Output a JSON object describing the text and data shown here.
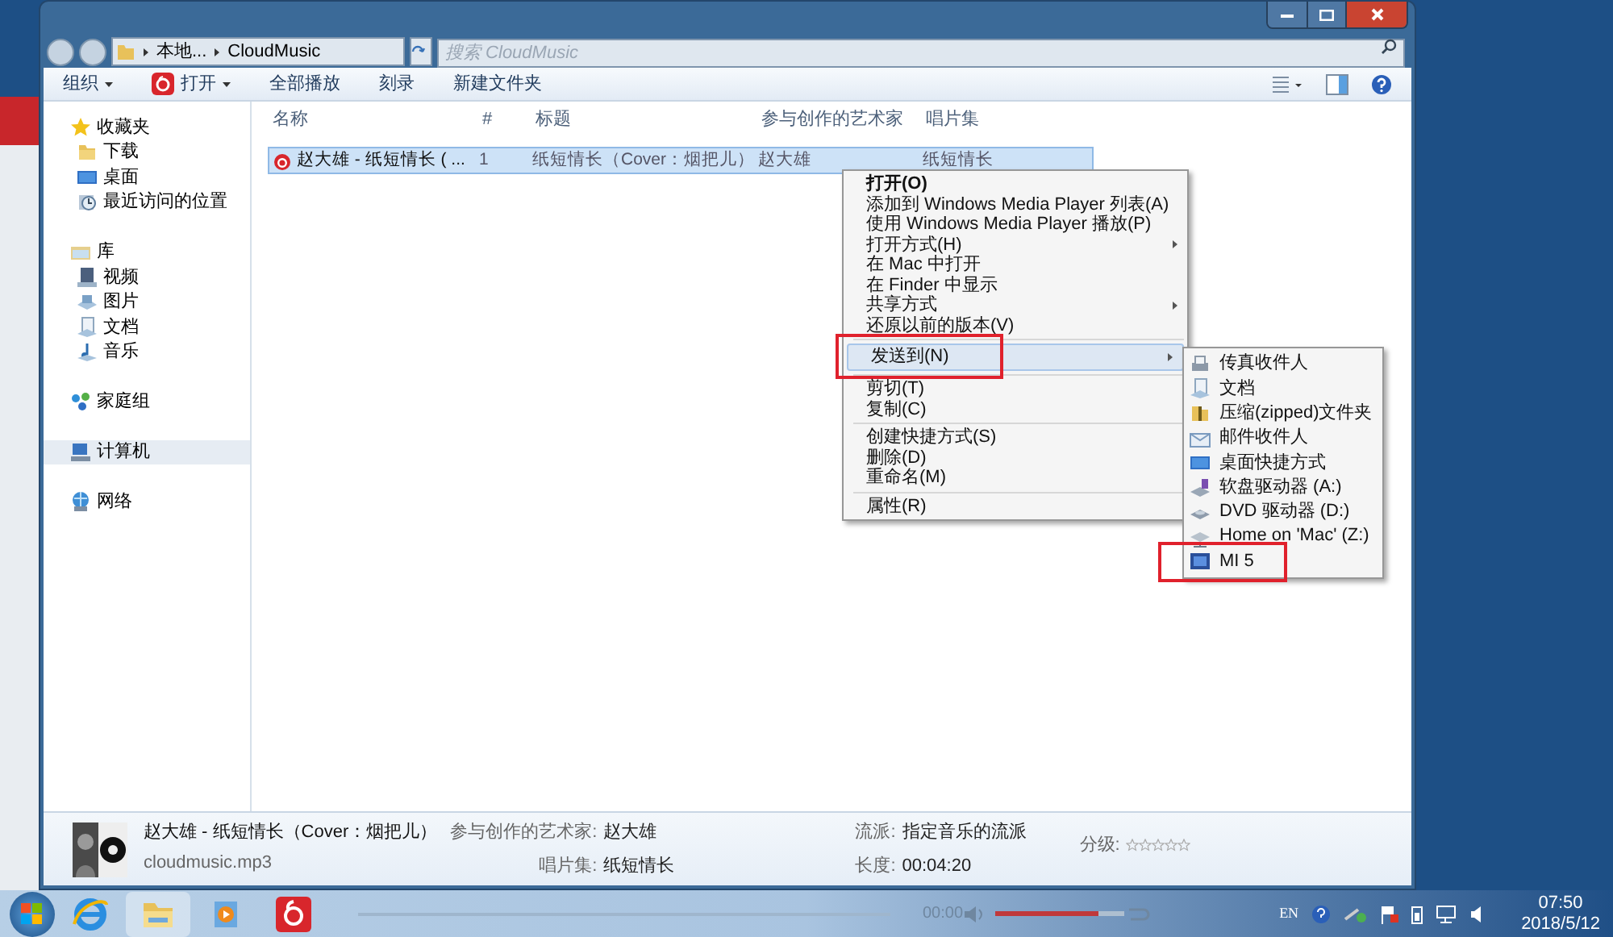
{
  "window": {
    "address": [
      "本地...",
      "CloudMusic"
    ],
    "search": {
      "placeholder": "搜索 CloudMusic"
    }
  },
  "toolbar": [
    {
      "label": "组织",
      "kind": "plain",
      "dropdown": true
    },
    {
      "label": "打开",
      "kind": "app",
      "dropdown": true
    },
    {
      "label": "全部播放",
      "kind": "plain",
      "dropdown": false
    },
    {
      "label": "刻录",
      "kind": "plain",
      "dropdown": false
    },
    {
      "label": "新建文件夹",
      "kind": "plain",
      "dropdown": false
    }
  ],
  "nav": [
    {
      "label": "收藏夹",
      "kind": "star",
      "selected": false,
      "children": [
        {
          "label": "下载",
          "kind": "folder",
          "selected": false
        },
        {
          "label": "桌面",
          "kind": "desktop",
          "selected": false
        },
        {
          "label": "最近访问的位置",
          "kind": "recent",
          "selected": false
        }
      ]
    },
    {
      "label": "库",
      "kind": "library",
      "selected": false,
      "children": [
        {
          "label": "视频",
          "kind": "video",
          "selected": false
        },
        {
          "label": "图片",
          "kind": "picture",
          "selected": false
        },
        {
          "label": "文档",
          "kind": "document",
          "selected": false
        },
        {
          "label": "音乐",
          "kind": "music",
          "selected": false
        }
      ]
    },
    {
      "label": "家庭组",
      "kind": "homegroup",
      "selected": false
    },
    {
      "label": "计算机",
      "kind": "computer",
      "selected": true
    },
    {
      "label": "网络",
      "kind": "network",
      "selected": false
    }
  ],
  "table": {
    "columns": [
      "名称",
      "#",
      "标题",
      "参与创作的艺术家",
      "唱片集"
    ],
    "rows": [
      {
        "cells": [
          "赵大雄 - 纸短情长 ( ...",
          "1",
          "纸短情长（Cover：烟把儿）",
          "赵大雄",
          "纸短情长"
        ],
        "selected": true
      }
    ]
  },
  "context_menu": {
    "groups": [
      [
        {
          "label": "打开(O)",
          "bold": true,
          "submenu": false,
          "selected": false,
          "annotated": false
        },
        {
          "label": "添加到 Windows Media Player 列表(A)",
          "bold": false,
          "submenu": false,
          "selected": false,
          "annotated": false
        },
        {
          "label": "使用 Windows Media Player 播放(P)",
          "bold": false,
          "submenu": false,
          "selected": false,
          "annotated": false
        },
        {
          "label": "打开方式(H)",
          "bold": false,
          "submenu": true,
          "selected": false,
          "annotated": false
        },
        {
          "label": "在 Mac 中打开",
          "bold": false,
          "submenu": false,
          "selected": false,
          "annotated": false
        },
        {
          "label": "在 Finder 中显示",
          "bold": false,
          "submenu": false,
          "selected": false,
          "annotated": false
        },
        {
          "label": "共享方式",
          "bold": false,
          "submenu": true,
          "selected": false,
          "annotated": false
        },
        {
          "label": "还原以前的版本(V)",
          "bold": false,
          "submenu": false,
          "selected": false,
          "annotated": false
        }
      ],
      [
        {
          "label": "发送到(N)",
          "bold": false,
          "submenu": true,
          "selected": true,
          "annotated": true
        }
      ],
      [
        {
          "label": "剪切(T)",
          "bold": false,
          "submenu": false,
          "selected": false,
          "annotated": false
        },
        {
          "label": "复制(C)",
          "bold": false,
          "submenu": false,
          "selected": false,
          "annotated": false
        }
      ],
      [
        {
          "label": "创建快捷方式(S)",
          "bold": false,
          "submenu": false,
          "selected": false,
          "annotated": false
        },
        {
          "label": "删除(D)",
          "bold": false,
          "submenu": false,
          "selected": false,
          "annotated": false
        },
        {
          "label": "重命名(M)",
          "bold": false,
          "submenu": false,
          "selected": false,
          "annotated": false
        }
      ],
      [
        {
          "label": "属性(R)",
          "bold": false,
          "submenu": false,
          "selected": false,
          "annotated": false
        }
      ]
    ]
  },
  "send_to_menu": [
    {
      "label": "传真收件人",
      "kind": "fax",
      "annotated": false
    },
    {
      "label": "文档",
      "kind": "document",
      "annotated": false
    },
    {
      "label": "压缩(zipped)文件夹",
      "kind": "zip",
      "annotated": false
    },
    {
      "label": "邮件收件人",
      "kind": "mail",
      "annotated": false
    },
    {
      "label": "桌面快捷方式",
      "kind": "desktop",
      "annotated": false
    },
    {
      "label": "软盘驱动器 (A:)",
      "kind": "floppy",
      "annotated": false
    },
    {
      "label": "DVD 驱动器 (D:)",
      "kind": "dvd",
      "annotated": false
    },
    {
      "label": "Home on 'Mac' (Z:)",
      "kind": "netdrive",
      "annotated": false
    },
    {
      "label": "MI 5",
      "kind": "device",
      "annotated": true
    }
  ],
  "details": {
    "title": "赵大雄 - 纸短情长（Cover：烟把儿）",
    "filename": "cloudmusic.mp3",
    "fields": [
      {
        "label": "参与创作的艺术家:",
        "value": "赵大雄"
      },
      {
        "label": "唱片集:",
        "value": "纸短情长"
      },
      {
        "label": "流派:",
        "value": "指定音乐的流派"
      },
      {
        "label": "长度:",
        "value": "00:04:20"
      }
    ],
    "rating": {
      "label": "分级:",
      "stars": 0
    }
  },
  "taskbar": {
    "apps": [
      {
        "kind": "ie"
      },
      {
        "kind": "explorer"
      },
      {
        "kind": "media"
      },
      {
        "kind": "netease"
      }
    ],
    "player": {
      "time": "00:00",
      "volume": {
        "level": 0.8
      }
    },
    "tray": {
      "language": "EN",
      "time": "07:50",
      "date": "2018/5/12"
    }
  }
}
